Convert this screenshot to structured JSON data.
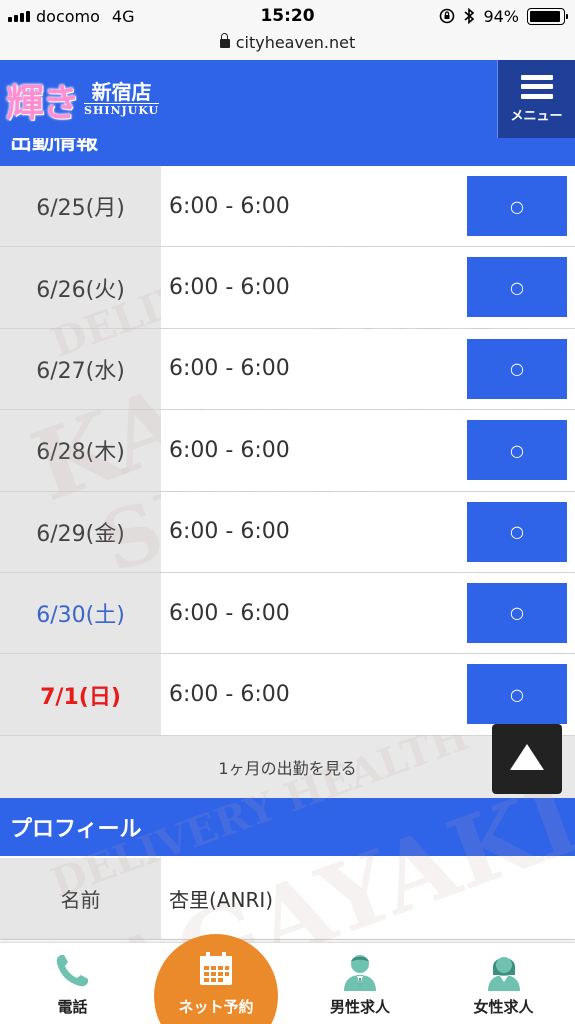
{
  "status_bar": {
    "carrier": "docomo",
    "network": "4G",
    "time": "15:20",
    "battery": "94%",
    "battery_level": 0.94
  },
  "browser": {
    "url": "cityheaven.net"
  },
  "header": {
    "logo_text": "輝き",
    "store_name": "新宿店",
    "store_city": "SHINJUKU",
    "menu_label": "メニュー"
  },
  "attendance": {
    "section_title": "出勤情報",
    "rows": [
      {
        "date": "6/25(月)",
        "time": "6:00 - 6:00",
        "status": "○"
      },
      {
        "date": "6/26(火)",
        "time": "6:00 - 6:00",
        "status": "○"
      },
      {
        "date": "6/27(水)",
        "time": "6:00 - 6:00",
        "status": "○"
      },
      {
        "date": "6/28(木)",
        "time": "6:00 - 6:00",
        "status": "○"
      },
      {
        "date": "6/29(金)",
        "time": "6:00 - 6:00",
        "status": "○"
      },
      {
        "date": "6/30(土)",
        "time": "6:00 - 6:00",
        "status": "○"
      },
      {
        "date": "7/1(日)",
        "time": "6:00 - 6:00",
        "status": "○"
      }
    ],
    "month_link": "1ヶ月の出勤を見る"
  },
  "profile": {
    "section_title": "プロフィール",
    "rows": [
      {
        "label": "名前",
        "value": "杏里(ANRI)"
      }
    ]
  },
  "watermark": {
    "line1": "DELIVERY HEALTH",
    "line2": "KAGAYAKI",
    "line3": "SHINJUKU"
  },
  "bottom_nav": {
    "phone": "電話",
    "reserve": "ネット予約",
    "male_jobs": "男性求人",
    "female_jobs": "女性求人"
  },
  "colors": {
    "primary": "#2f63e8",
    "accent": "#ea8a2a",
    "saturday": "#3a65c9",
    "sunday": "#e81b1b"
  }
}
